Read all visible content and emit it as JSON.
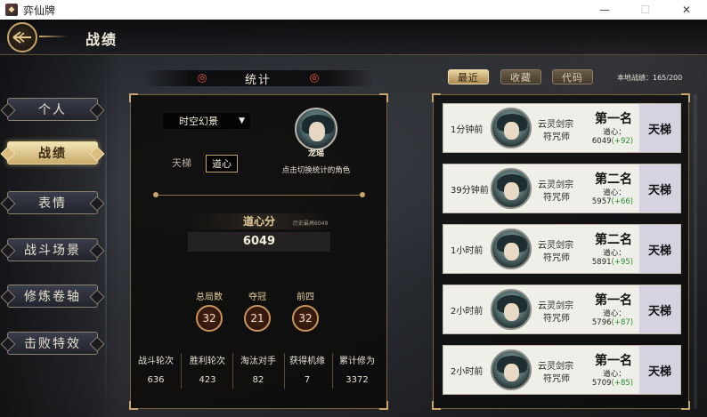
{
  "window": {
    "title": "弈仙牌",
    "minimize": "—",
    "maximize": "☐",
    "close": "✕"
  },
  "header": {
    "title": "战绩"
  },
  "sidebar": {
    "items": [
      {
        "label": "个人"
      },
      {
        "label": "战绩",
        "active": true
      },
      {
        "label": "表情"
      },
      {
        "label": "战斗场景"
      },
      {
        "label": "修炼卷轴"
      },
      {
        "label": "击败特效"
      }
    ]
  },
  "stats": {
    "heading": "统计",
    "dropdown_value": "时空幻景",
    "mode_tabs": [
      {
        "label": "天梯"
      },
      {
        "label": "道心",
        "active": true
      }
    ],
    "character_name": "龙瑶",
    "character_hint": "点击切换统计的角色",
    "score_label": "道心分",
    "score_history": "历史最高6049",
    "score_value": "6049",
    "medals": [
      {
        "label": "总局数",
        "value": "32"
      },
      {
        "label": "夺冠",
        "value": "21"
      },
      {
        "label": "前四",
        "value": "32"
      }
    ],
    "metrics": [
      {
        "label": "战斗轮次",
        "value": "636"
      },
      {
        "label": "胜利轮次",
        "value": "423"
      },
      {
        "label": "淘汰对手",
        "value": "82"
      },
      {
        "label": "获得机缘",
        "value": "7"
      },
      {
        "label": "累计修为",
        "value": "3372"
      }
    ]
  },
  "history": {
    "tabs": [
      {
        "label": "最近",
        "active": true
      },
      {
        "label": "收藏"
      },
      {
        "label": "代码"
      }
    ],
    "local_count": "本地战绩：165/200",
    "records": [
      {
        "time": "1分钟前",
        "sect": "云灵剑宗",
        "role": "符咒师",
        "rank": "第一名",
        "daoxin_label": "道心：",
        "score": "6049",
        "delta": "(+92)",
        "mode": "天梯"
      },
      {
        "time": "39分钟前",
        "sect": "云灵剑宗",
        "role": "符咒师",
        "rank": "第二名",
        "daoxin_label": "道心：",
        "score": "5957",
        "delta": "(+66)",
        "mode": "天梯"
      },
      {
        "time": "1小时前",
        "sect": "云灵剑宗",
        "role": "符咒师",
        "rank": "第二名",
        "daoxin_label": "道心：",
        "score": "5891",
        "delta": "(+95)",
        "mode": "天梯"
      },
      {
        "time": "2小时前",
        "sect": "云灵剑宗",
        "role": "符咒师",
        "rank": "第一名",
        "daoxin_label": "道心：",
        "score": "5796",
        "delta": "(+87)",
        "mode": "天梯"
      },
      {
        "time": "2小时前",
        "sect": "云灵剑宗",
        "role": "符咒师",
        "rank": "第一名",
        "daoxin_label": "道心：",
        "score": "5709",
        "delta": "(+85)",
        "mode": "天梯"
      }
    ]
  },
  "colors": {
    "gold": "#c9a46a",
    "green_delta": "#2e8b2e",
    "mode_bg": "#d7d2e0"
  }
}
